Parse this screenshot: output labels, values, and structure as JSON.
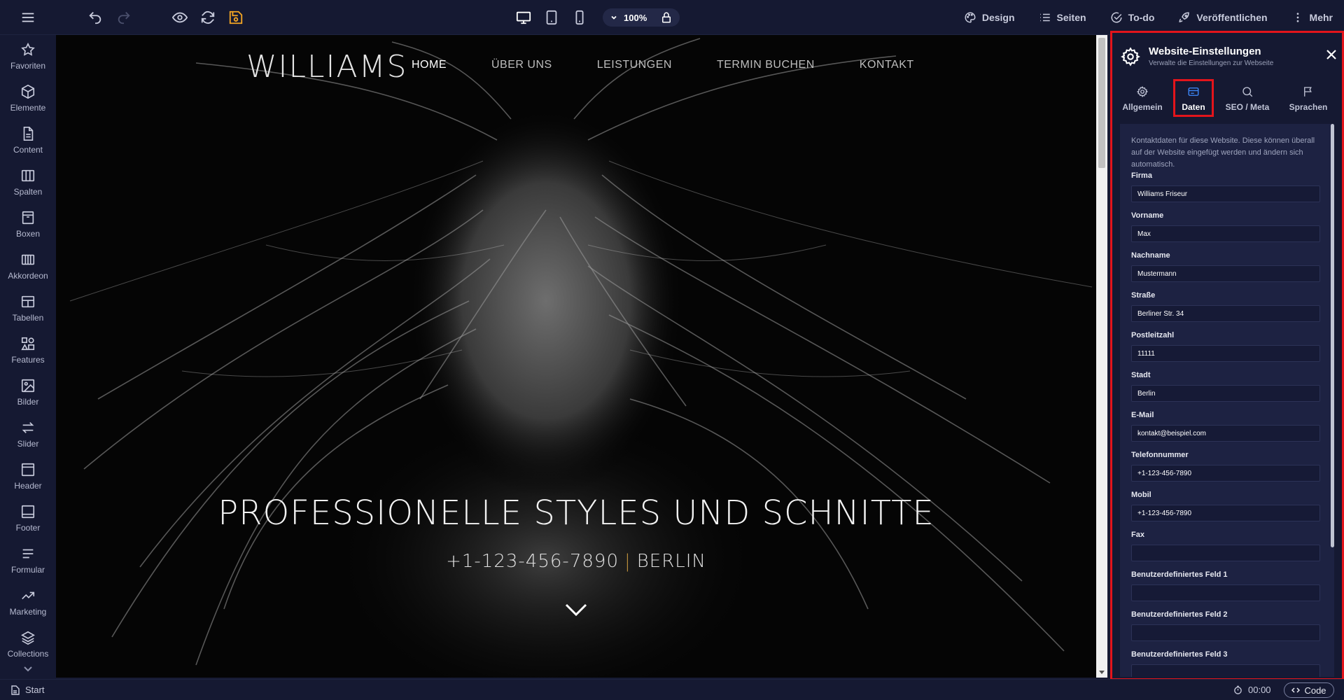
{
  "toolbar": {
    "zoom": "100%",
    "right": [
      {
        "label": "Design",
        "icon": "palette-icon"
      },
      {
        "label": "Seiten",
        "icon": "list-icon"
      },
      {
        "label": "To-do",
        "icon": "check-circle-icon"
      },
      {
        "label": "Veröffentlichen",
        "icon": "rocket-icon"
      },
      {
        "label": "Mehr",
        "icon": "more-vertical-icon"
      }
    ]
  },
  "sidebar": {
    "items": [
      {
        "label": "Favoriten",
        "icon": "star-icon"
      },
      {
        "label": "Elemente",
        "icon": "cube-icon"
      },
      {
        "label": "Content",
        "icon": "document-icon"
      },
      {
        "label": "Spalten",
        "icon": "columns-icon"
      },
      {
        "label": "Boxen",
        "icon": "box-icon"
      },
      {
        "label": "Akkordeon",
        "icon": "accordion-icon"
      },
      {
        "label": "Tabellen",
        "icon": "table-icon"
      },
      {
        "label": "Features",
        "icon": "features-icon"
      },
      {
        "label": "Bilder",
        "icon": "image-icon"
      },
      {
        "label": "Slider",
        "icon": "slider-arrows-icon"
      },
      {
        "label": "Header",
        "icon": "header-icon"
      },
      {
        "label": "Footer",
        "icon": "footer-icon"
      },
      {
        "label": "Formular",
        "icon": "form-icon"
      },
      {
        "label": "Marketing",
        "icon": "trend-icon"
      },
      {
        "label": "Collections",
        "icon": "layers-icon"
      }
    ]
  },
  "site": {
    "logo": "WILLIAMS",
    "nav": [
      "HOME",
      "ÜBER UNS",
      "LEISTUNGEN",
      "TERMIN BUCHEN",
      "KONTAKT"
    ],
    "hero_title": "PROFESSIONELLE STYLES UND SCHNITTE",
    "hero_phone": "+1-123-456-7890",
    "hero_separator": "|",
    "hero_city": "BERLIN"
  },
  "panel": {
    "title": "Website-Einstellungen",
    "subtitle": "Verwalte die Einstellungen zur Webseite",
    "tabs": [
      {
        "label": "Allgemein",
        "icon": "gear-outline-icon"
      },
      {
        "label": "Daten",
        "icon": "id-card-icon"
      },
      {
        "label": "SEO / Meta",
        "icon": "search-icon"
      },
      {
        "label": "Sprachen",
        "icon": "flag-icon"
      }
    ],
    "active_tab": "Daten",
    "intro": "Kontaktdaten für diese Website. Diese können überall auf der Website eingefügt werden und ändern sich automatisch.",
    "fields": [
      {
        "label": "Firma",
        "value": "Williams Friseur"
      },
      {
        "label": "Vorname",
        "value": "Max"
      },
      {
        "label": "Nachname",
        "value": "Mustermann"
      },
      {
        "label": "Straße",
        "value": "Berliner Str. 34"
      },
      {
        "label": "Postleitzahl",
        "value": "11111"
      },
      {
        "label": "Stadt",
        "value": "Berlin"
      },
      {
        "label": "E-Mail",
        "value": "kontakt@beispiel.com"
      },
      {
        "label": "Telefonnummer",
        "value": "+1-123-456-7890"
      },
      {
        "label": "Mobil",
        "value": "+1-123-456-7890"
      },
      {
        "label": "Fax",
        "value": ""
      },
      {
        "label": "Benutzerdefiniertes Feld 1",
        "value": ""
      },
      {
        "label": "Benutzerdefiniertes Feld 2",
        "value": ""
      },
      {
        "label": "Benutzerdefiniertes Feld 3",
        "value": ""
      }
    ]
  },
  "bottom": {
    "start": "Start",
    "timer": "00:00",
    "code": "Code"
  },
  "colors": {
    "background": "#161a33",
    "highlight": "#e3141b",
    "save_accent": "#f5a623",
    "active_tab": "#3d8bff"
  }
}
